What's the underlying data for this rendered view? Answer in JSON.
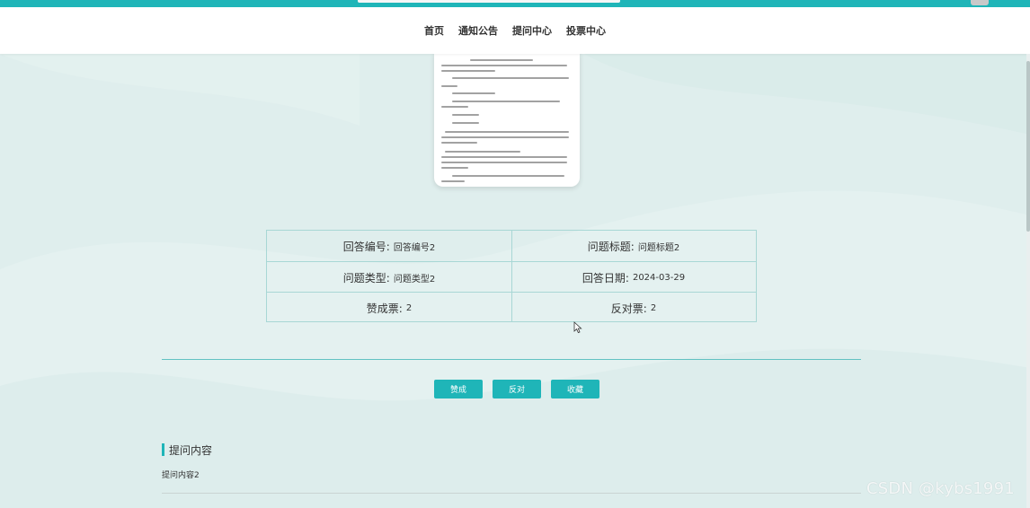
{
  "nav": {
    "items": [
      {
        "label": "首页"
      },
      {
        "label": "通知公告"
      },
      {
        "label": "提问中心"
      },
      {
        "label": "投票中心"
      }
    ]
  },
  "details": {
    "answer_no_label": "回答编号:",
    "answer_no_value": "回答编号2",
    "question_title_label": "问题标题:",
    "question_title_value": "问题标题2",
    "question_type_label": "问题类型:",
    "question_type_value": "问题类型2",
    "answer_date_label": "回答日期:",
    "answer_date_value": "2024-03-29",
    "upvotes_label": "赞成票:",
    "upvotes_value": "2",
    "downvotes_label": "反对票:",
    "downvotes_value": "2"
  },
  "actions": {
    "agree_label": "赞成",
    "oppose_label": "反对",
    "favorite_label": "收藏"
  },
  "section": {
    "title": "提问内容",
    "body": "提问内容2"
  },
  "watermark": "CSDN @kybs1991",
  "colors": {
    "accent": "#1fb5b8",
    "background": "#dfeeed",
    "table_border": "#a8d7d5"
  }
}
